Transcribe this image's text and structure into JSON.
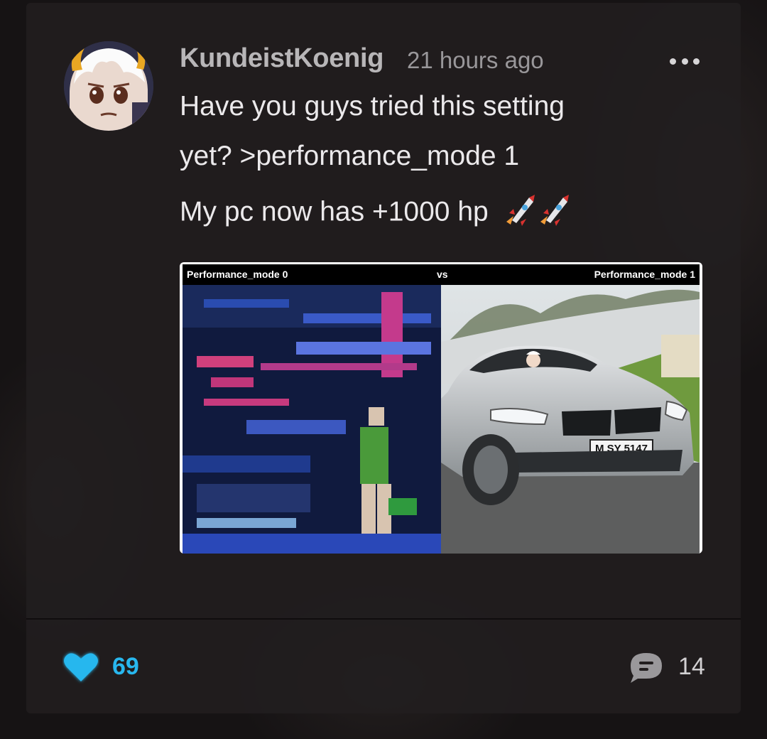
{
  "post": {
    "username": "KundeistKoenig",
    "timestamp": "21 hours ago",
    "lines": [
      "Have you guys tried this setting",
      "yet? >performance_mode 1",
      "My pc now has +1000 hp"
    ],
    "emoji": "rocket-icon rocket-icon"
  },
  "image": {
    "left_caption": "Performance_mode 0",
    "middle_caption": "vs",
    "right_caption": "Performance_mode 1",
    "license_plate": "M SY 5147"
  },
  "footer": {
    "likes": "69",
    "comments": "14"
  },
  "colors": {
    "like_accent": "#28b7ee",
    "card_bg": "#221e1f",
    "text": "#ebe9eb"
  },
  "icons": {
    "more": "more-options-icon",
    "like": "heart-icon",
    "comment": "comment-bubble-icon"
  }
}
